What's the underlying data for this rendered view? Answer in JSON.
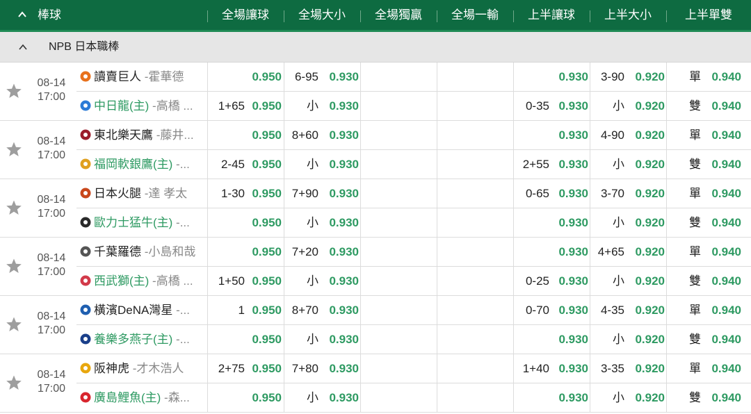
{
  "header": {
    "sport": "棒球",
    "columns": [
      "全場讓球",
      "全場大小",
      "全場獨贏",
      "全場一輸",
      "上半讓球",
      "上半大小",
      "上半單雙"
    ]
  },
  "league": {
    "name": "NPB 日本職棒"
  },
  "matches": [
    {
      "date": "08-14",
      "time": "17:00",
      "away": {
        "name": "讀賣巨人",
        "pitcher": " -霍華德"
      },
      "home": {
        "name": "中日龍(主)",
        "pitcher": " -高橋 ..."
      },
      "colors": [
        "#e8711c",
        "#2b7bd6"
      ],
      "top": {
        "fh_line": "",
        "fh_odds": "0.950",
        "ou_line": "6-95",
        "ou_odds": "0.930",
        "hh_line": "",
        "hh_odds": "0.930",
        "hou_line": "3-90",
        "hou_odds": "0.920",
        "oe_label": "單",
        "oe_odds": "0.940"
      },
      "bot": {
        "fh_line": "1+65",
        "fh_odds": "0.950",
        "ou_line": "小",
        "ou_odds": "0.930",
        "hh_line": "0-35",
        "hh_odds": "0.930",
        "hou_line": "小",
        "hou_odds": "0.920",
        "oe_label": "雙",
        "oe_odds": "0.940"
      }
    },
    {
      "date": "08-14",
      "time": "17:00",
      "away": {
        "name": "東北樂天鷹",
        "pitcher": " -藤井..."
      },
      "home": {
        "name": "福岡軟銀鷹(主)",
        "pitcher": " -..."
      },
      "colors": [
        "#9b1c2c",
        "#e0a020"
      ],
      "top": {
        "fh_line": "",
        "fh_odds": "0.950",
        "ou_line": "8+60",
        "ou_odds": "0.930",
        "hh_line": "",
        "hh_odds": "0.930",
        "hou_line": "4-90",
        "hou_odds": "0.920",
        "oe_label": "單",
        "oe_odds": "0.940"
      },
      "bot": {
        "fh_line": "2-45",
        "fh_odds": "0.950",
        "ou_line": "小",
        "ou_odds": "0.930",
        "hh_line": "2+55",
        "hh_odds": "0.930",
        "hou_line": "小",
        "hou_odds": "0.920",
        "oe_label": "雙",
        "oe_odds": "0.940"
      }
    },
    {
      "date": "08-14",
      "time": "17:00",
      "away": {
        "name": "日本火腿",
        "pitcher": " -達 孝太"
      },
      "home": {
        "name": "歐力士猛牛(主)",
        "pitcher": " -..."
      },
      "colors": [
        "#c9471b",
        "#2a2a2a"
      ],
      "top": {
        "fh_line": "1-30",
        "fh_odds": "0.950",
        "ou_line": "7+90",
        "ou_odds": "0.930",
        "hh_line": "0-65",
        "hh_odds": "0.930",
        "hou_line": "3-70",
        "hou_odds": "0.920",
        "oe_label": "單",
        "oe_odds": "0.940"
      },
      "bot": {
        "fh_line": "",
        "fh_odds": "0.950",
        "ou_line": "小",
        "ou_odds": "0.930",
        "hh_line": "",
        "hh_odds": "0.930",
        "hou_line": "小",
        "hou_odds": "0.920",
        "oe_label": "雙",
        "oe_odds": "0.940"
      }
    },
    {
      "date": "08-14",
      "time": "17:00",
      "away": {
        "name": "千葉羅德",
        "pitcher": " -小島和哉"
      },
      "home": {
        "name": "西武獅(主)",
        "pitcher": " -高橋 ..."
      },
      "colors": [
        "#555555",
        "#d23a4a"
      ],
      "top": {
        "fh_line": "",
        "fh_odds": "0.950",
        "ou_line": "7+20",
        "ou_odds": "0.930",
        "hh_line": "",
        "hh_odds": "0.930",
        "hou_line": "4+65",
        "hou_odds": "0.920",
        "oe_label": "單",
        "oe_odds": "0.940"
      },
      "bot": {
        "fh_line": "1+50",
        "fh_odds": "0.950",
        "ou_line": "小",
        "ou_odds": "0.930",
        "hh_line": "0-25",
        "hh_odds": "0.930",
        "hou_line": "小",
        "hou_odds": "0.920",
        "oe_label": "雙",
        "oe_odds": "0.940"
      }
    },
    {
      "date": "08-14",
      "time": "17:00",
      "away": {
        "name": "橫濱DeNA灣星",
        "pitcher": " -..."
      },
      "home": {
        "name": "養樂多燕子(主)",
        "pitcher": " -..."
      },
      "colors": [
        "#1f5fb0",
        "#1a3f8a"
      ],
      "top": {
        "fh_line": "1",
        "fh_odds": "0.950",
        "ou_line": "8+70",
        "ou_odds": "0.930",
        "hh_line": "0-70",
        "hh_odds": "0.930",
        "hou_line": "4-35",
        "hou_odds": "0.920",
        "oe_label": "單",
        "oe_odds": "0.940"
      },
      "bot": {
        "fh_line": "",
        "fh_odds": "0.950",
        "ou_line": "小",
        "ou_odds": "0.930",
        "hh_line": "",
        "hh_odds": "0.930",
        "hou_line": "小",
        "hou_odds": "0.920",
        "oe_label": "雙",
        "oe_odds": "0.940"
      }
    },
    {
      "date": "08-14",
      "time": "17:00",
      "away": {
        "name": "阪神虎",
        "pitcher": " -才木浩人"
      },
      "home": {
        "name": "廣島鯉魚(主)",
        "pitcher": " -森..."
      },
      "colors": [
        "#e8a70e",
        "#d8262e"
      ],
      "top": {
        "fh_line": "2+75",
        "fh_odds": "0.950",
        "ou_line": "7+80",
        "ou_odds": "0.930",
        "hh_line": "1+40",
        "hh_odds": "0.930",
        "hou_line": "3-35",
        "hou_odds": "0.920",
        "oe_label": "單",
        "oe_odds": "0.940"
      },
      "bot": {
        "fh_line": "",
        "fh_odds": "0.950",
        "ou_line": "小",
        "ou_odds": "0.930",
        "hh_line": "",
        "hh_odds": "0.930",
        "hou_line": "小",
        "hou_odds": "0.920",
        "oe_label": "雙",
        "oe_odds": "0.940"
      }
    }
  ],
  "colors": {
    "header_bg": "#0e6b41",
    "odds_green": "#2e9a62",
    "league_bg": "#e6e6e6",
    "star_gray": "#9e9e9e"
  },
  "icons": {
    "collapse": "chevron-up-icon",
    "favorite": "star-icon"
  }
}
